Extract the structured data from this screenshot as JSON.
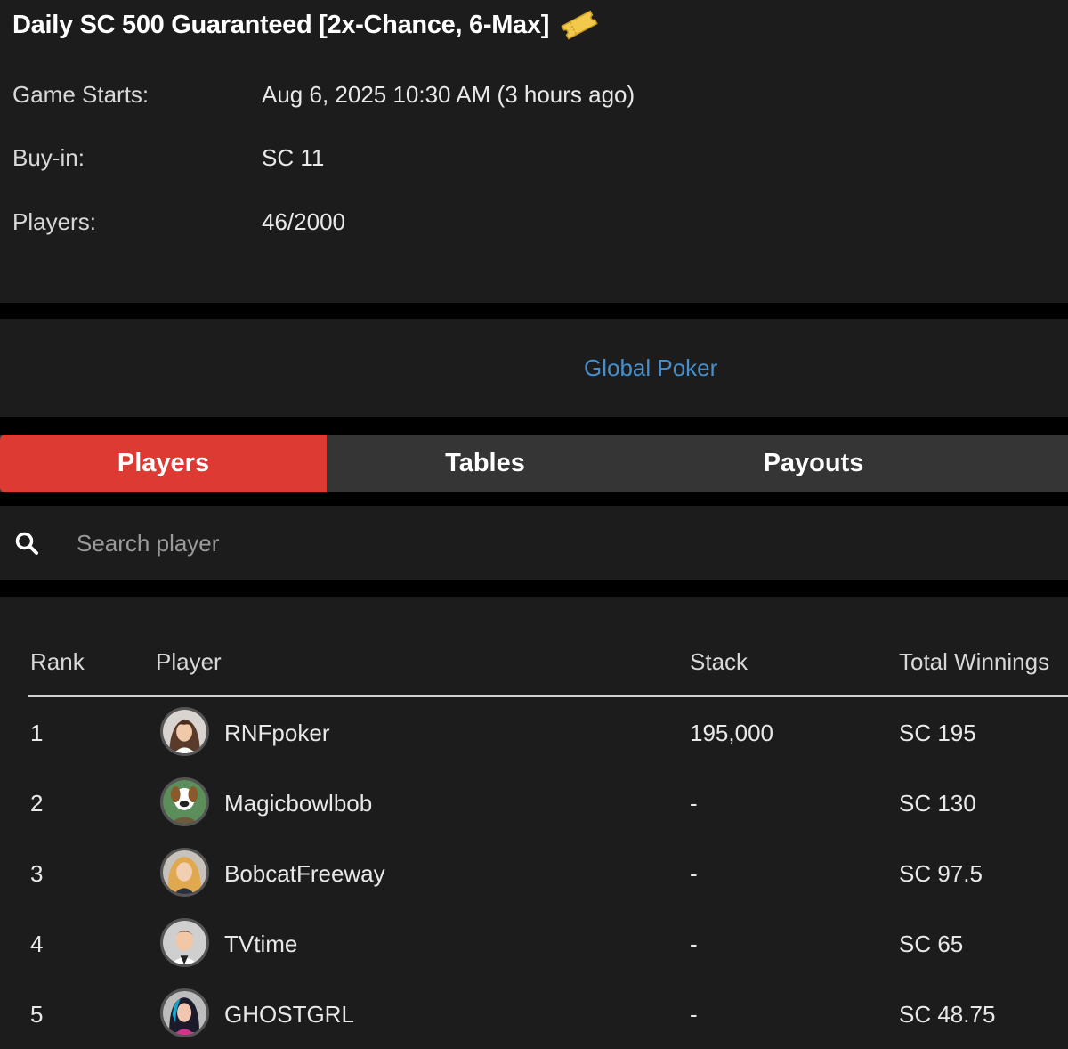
{
  "tournament": {
    "title": "Daily SC 500 Guaranteed [2x-Chance, 6-Max]",
    "ticket_icon": "ticket-icon",
    "fields": [
      {
        "label": "Game Starts:",
        "value": "Aug 6, 2025 10:30 AM (3 hours ago)"
      },
      {
        "label": "Buy-in:",
        "value": "SC 11"
      },
      {
        "label": "Players:",
        "value": "46/2000"
      }
    ]
  },
  "operator": {
    "name": "Global Poker",
    "link_color": "#4a8ec9"
  },
  "tabs": [
    {
      "label": "Players",
      "active": true
    },
    {
      "label": "Tables",
      "active": false
    },
    {
      "label": "Payouts",
      "active": false
    }
  ],
  "search": {
    "placeholder": "Search player",
    "value": "",
    "icon": "search-icon"
  },
  "table": {
    "headers": [
      "Rank",
      "Player",
      "Stack",
      "Total Winnings"
    ],
    "rows": [
      {
        "rank": "1",
        "player": "RNFpoker",
        "stack": "195,000",
        "winnings": "SC 195"
      },
      {
        "rank": "2",
        "player": "Magicbowlbob",
        "stack": "-",
        "winnings": "SC 130"
      },
      {
        "rank": "3",
        "player": "BobcatFreeway",
        "stack": "-",
        "winnings": "SC 97.5"
      },
      {
        "rank": "4",
        "player": "TVtime",
        "stack": "-",
        "winnings": "SC 65"
      },
      {
        "rank": "5",
        "player": "GHOSTGRL",
        "stack": "-",
        "winnings": "SC 48.75"
      }
    ]
  },
  "colors": {
    "accent": "#dc3a32",
    "panel": "#1c1c1c",
    "tab_inactive": "#353535"
  }
}
